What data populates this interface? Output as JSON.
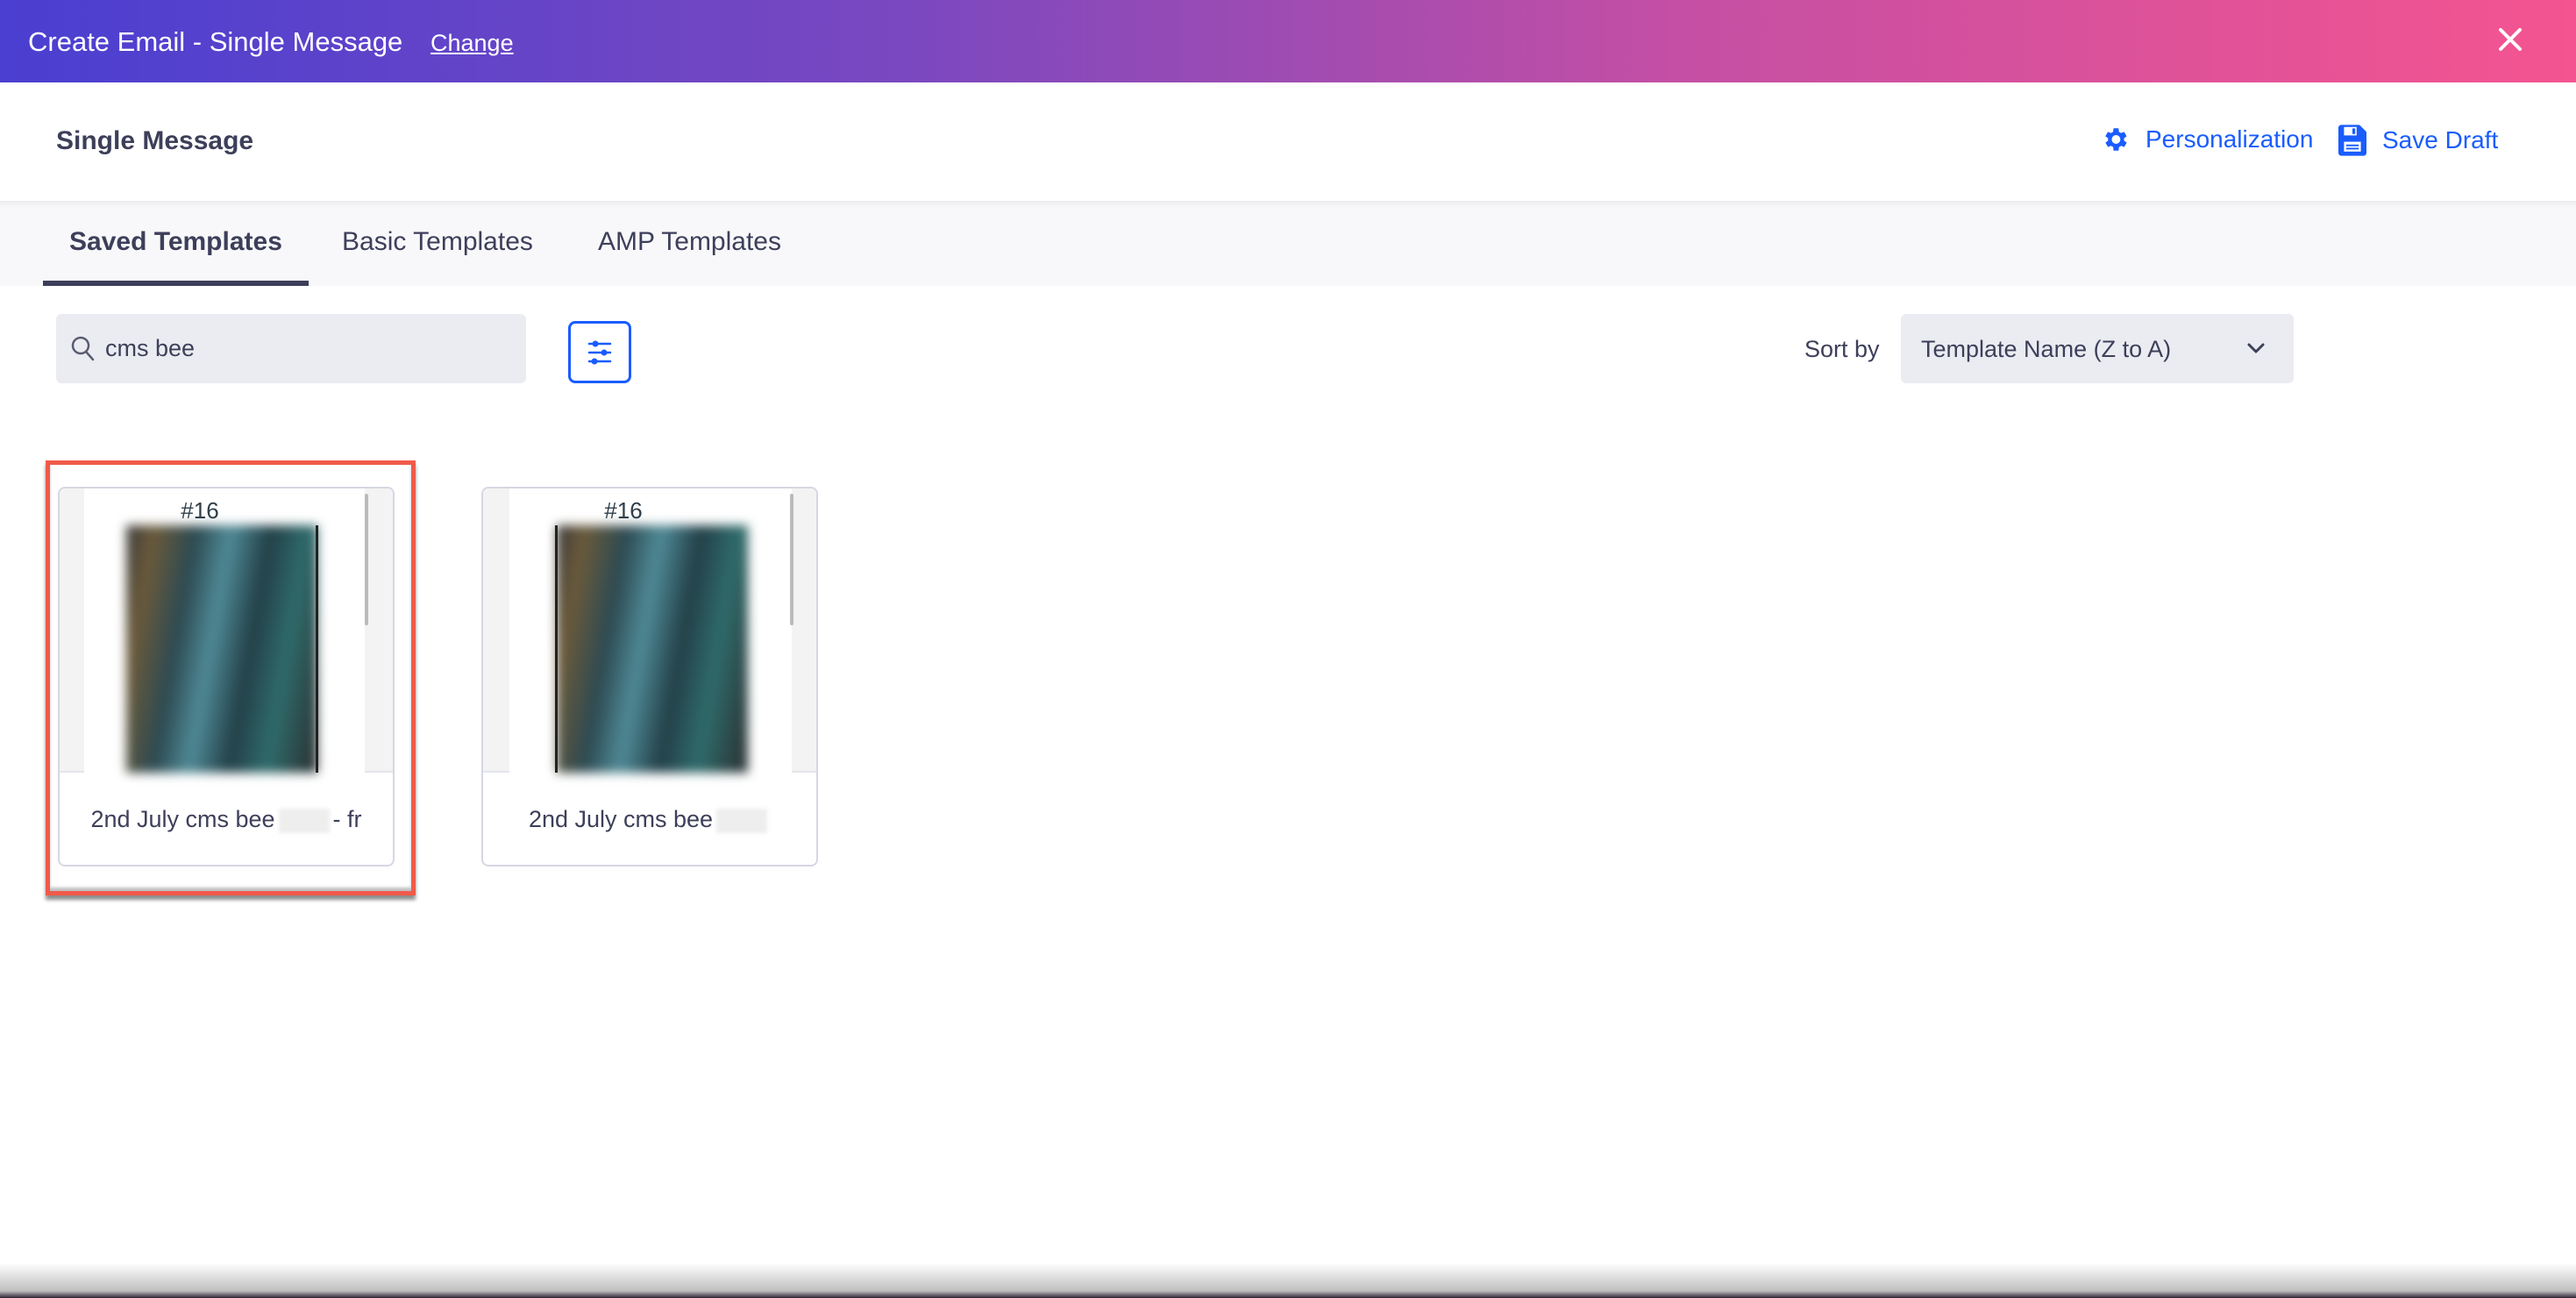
{
  "header": {
    "title": "Create Email - Single Message",
    "change_label": "Change",
    "close_icon": "close-icon",
    "gradient": [
      "#4a3fd1",
      "#f45490"
    ]
  },
  "subheader": {
    "title": "Single Message",
    "personalization_label": "Personalization",
    "save_draft_label": "Save Draft",
    "accent": "#1a5cff"
  },
  "tabs": [
    {
      "label": "Saved Templates",
      "active": true
    },
    {
      "label": "Basic Templates",
      "active": false
    },
    {
      "label": "AMP Templates",
      "active": false
    }
  ],
  "search": {
    "value": "cms bee"
  },
  "sort": {
    "label": "Sort by",
    "value": "Template Name (Z to A)"
  },
  "templates": [
    {
      "preview_title": "#16",
      "name": "2nd July cms bee",
      "name_suffix": "- fr",
      "highlighted": true
    },
    {
      "preview_title": "#16",
      "name": "2nd July cms bee",
      "name_suffix": "",
      "highlighted": false
    }
  ],
  "highlight_color": "#f05a4a"
}
